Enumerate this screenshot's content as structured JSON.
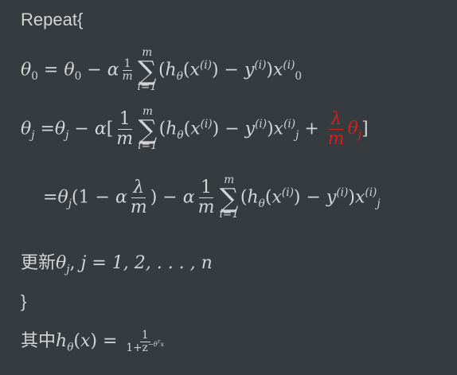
{
  "lines": {
    "repeat_open": "Repeat{",
    "close_brace": "}",
    "update_label": "更新",
    "where_label": "其中"
  },
  "symbols": {
    "theta": "θ",
    "alpha": "α",
    "lambda": "λ",
    "sigma": "∑",
    "sub0": "0",
    "subj": "j",
    "sum_upper": "m",
    "sum_lower": "i=1",
    "one": "1",
    "m": "m",
    "h": "h",
    "x": "x",
    "y": "y",
    "sup_i": "(i)",
    "minus": "−",
    "plus": "+",
    "equals": "=",
    "j_list": "j = 1, 2, . . . , n",
    "sigmoid_den": "1+z",
    "sigmoid_exp": "−θ",
    "sigmoid_T": "T",
    "sigmoid_x": "x"
  },
  "colors": {
    "background": "#363b3f",
    "text": "#d4d4d4",
    "highlight": "#d6201c"
  }
}
